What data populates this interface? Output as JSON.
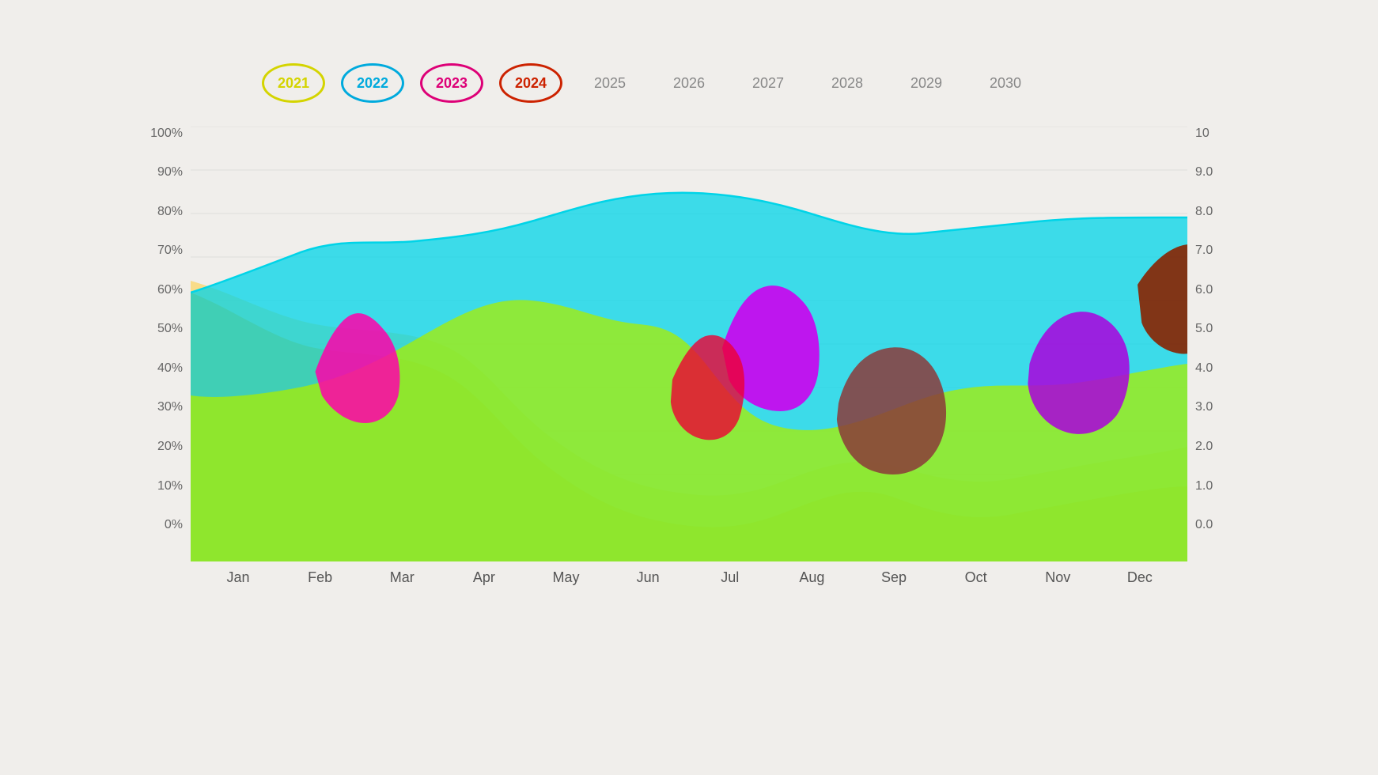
{
  "legend": {
    "years_circled": [
      {
        "year": "2021",
        "color": "#d4d400"
      },
      {
        "year": "2022",
        "color": "#00aadd"
      },
      {
        "year": "2023",
        "color": "#dd0077"
      },
      {
        "year": "2024",
        "color": "#cc2200"
      }
    ],
    "years_plain": [
      "2025",
      "2026",
      "2027",
      "2028",
      "2029",
      "2030"
    ]
  },
  "y_axis_left": [
    "100%",
    "90%",
    "80%",
    "70%",
    "60%",
    "50%",
    "40%",
    "30%",
    "20%",
    "10%",
    "0%"
  ],
  "y_axis_right": [
    "10",
    "9.0",
    "8.0",
    "7.0",
    "6.0",
    "5.0",
    "4.0",
    "3.0",
    "2.0",
    "1.0",
    "0.0"
  ],
  "x_axis": [
    "Jan",
    "Feb",
    "Mar",
    "Apr",
    "May",
    "Jun",
    "Jul",
    "Aug",
    "Sep",
    "Oct",
    "Nov",
    "Dec"
  ]
}
